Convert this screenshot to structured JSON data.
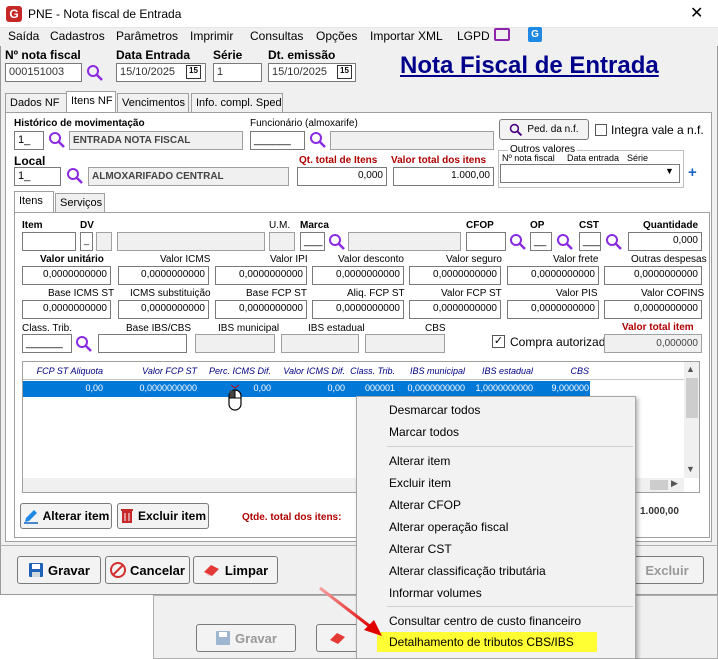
{
  "window": {
    "title": "PNE - Nota fiscal de Entrada"
  },
  "menu": [
    "Saída",
    "Cadastros",
    "Parâmetros",
    "Imprimir",
    "Consultas",
    "Opções",
    "Importar XML",
    "LGPD"
  ],
  "header": {
    "nota_label": "Nº nota fiscal",
    "nota_value": "000151003",
    "data_label": "Data Entrada",
    "data_value": "15/10/2025",
    "serie_label": "Série",
    "serie_value": "1",
    "emissao_label": "Dt. emissão",
    "emissao_value": "15/10/2025",
    "big_title": "Nota Fiscal de Entrada"
  },
  "tabs": [
    "Dados NF",
    "Itens NF",
    "Vencimentos",
    "Info. compl. Sped"
  ],
  "form": {
    "historico_label": "Histórico de movimentação",
    "historico_code": "1_",
    "historico_desc": "ENTRADA NOTA FISCAL",
    "funcionario_label": "Funcionário (almoxarife)",
    "funcionario_code": "______",
    "ped_button": "Ped. da n.f.",
    "integra_label": "Integra vale a n.f.",
    "local_label": "Local",
    "local_code": "1_",
    "local_desc": "ALMOXARIFADO CENTRAL",
    "qt_total_label": "Qt. total de Itens",
    "qt_total_value": "0,000",
    "valor_total_label": "Valor total dos itens",
    "valor_total_value": "1.000,00",
    "outros_label": "Outros valores",
    "outros_nota": "Nº nota fiscal",
    "outros_data": "Data entrada",
    "outros_serie": "Série",
    "plus": "+"
  },
  "subtabs": [
    "Itens",
    "Serviços"
  ],
  "item": {
    "item_label": "Item",
    "dv_label": "DV",
    "dv_value": "_",
    "um_label": "U.M.",
    "marca_label": "Marca",
    "marca_value": "___",
    "cfop_label": "CFOP",
    "op_label": "OP",
    "op_value": "__",
    "cst_label": "CST",
    "cst_value": "___",
    "quantidade_label": "Quantidade",
    "quantidade_value": "0,000"
  },
  "row1": [
    {
      "label": "Valor unitário",
      "value": "0,0000000000",
      "bold": true
    },
    {
      "label": "Valor ICMS",
      "value": "0,0000000000"
    },
    {
      "label": "Valor IPI",
      "value": "0,0000000000"
    },
    {
      "label": "Valor desconto",
      "value": "0,0000000000"
    },
    {
      "label": "Valor seguro",
      "value": "0,0000000000"
    },
    {
      "label": "Valor frete",
      "value": "0,0000000000"
    },
    {
      "label": "Outras despesas",
      "value": "0,0000000000"
    }
  ],
  "row2": [
    {
      "label": "Base ICMS ST",
      "value": "0,0000000000"
    },
    {
      "label": "ICMS substituição",
      "value": "0,0000000000"
    },
    {
      "label": "Base FCP ST",
      "value": "0,0000000000"
    },
    {
      "label": "Aliq. FCP ST",
      "value": "0,0000000000"
    },
    {
      "label": "Valor FCP ST",
      "value": "0,0000000000"
    },
    {
      "label": "Valor PIS",
      "value": "0,0000000000"
    },
    {
      "label": "Valor COFINS",
      "value": "0,0000000000"
    }
  ],
  "row3": {
    "class_label": "Class. Trib.",
    "class_value": "______",
    "base_ibs_label": "Base IBS/CBS",
    "ibs_mun_label": "IBS municipal",
    "ibs_est_label": "IBS estadual",
    "cbs_label": "CBS",
    "compra_label": "Compra autorizada",
    "valor_total_item_label": "Valor total item",
    "valor_total_item_value": "0,000000"
  },
  "grid": {
    "columns": [
      "FCP ST Aliquota",
      "Valor FCP ST",
      "Perc. ICMS Dif.",
      "Valor ICMS Dif.",
      "Class. Trib.",
      "IBS municipal",
      "IBS estadual",
      "CBS"
    ],
    "row": [
      "0,00",
      "0,0000000000",
      "0,00",
      "0,00",
      "000001",
      "0,0000000000",
      "1,0000000000",
      "9,000000"
    ]
  },
  "buttons": {
    "alterar_item": "Alterar item",
    "excluir_item": "Excluir item",
    "qtde_label": "Qtde. total dos itens:",
    "total_value": "1.000,00",
    "gravar": "Gravar",
    "cancelar": "Cancelar",
    "limpar": "Limpar",
    "excluir": "Excluir"
  },
  "bottom": {
    "gravar": "Gravar"
  },
  "context_menu": [
    "Desmarcar todos",
    "Marcar todos",
    "Alterar item",
    "Excluir item",
    "Alterar CFOP",
    "Alterar operação fiscal",
    "Alterar CST",
    "Alterar classificação tributária",
    "Informar volumes",
    "Consultar centro de custo financeiro",
    "Detalhamento de tributos CBS/IBS"
  ],
  "colors": {
    "title_blue": "#00008b",
    "accent_red": "#b00000",
    "selection": "#0078d7",
    "highlight": "#ffff33"
  }
}
